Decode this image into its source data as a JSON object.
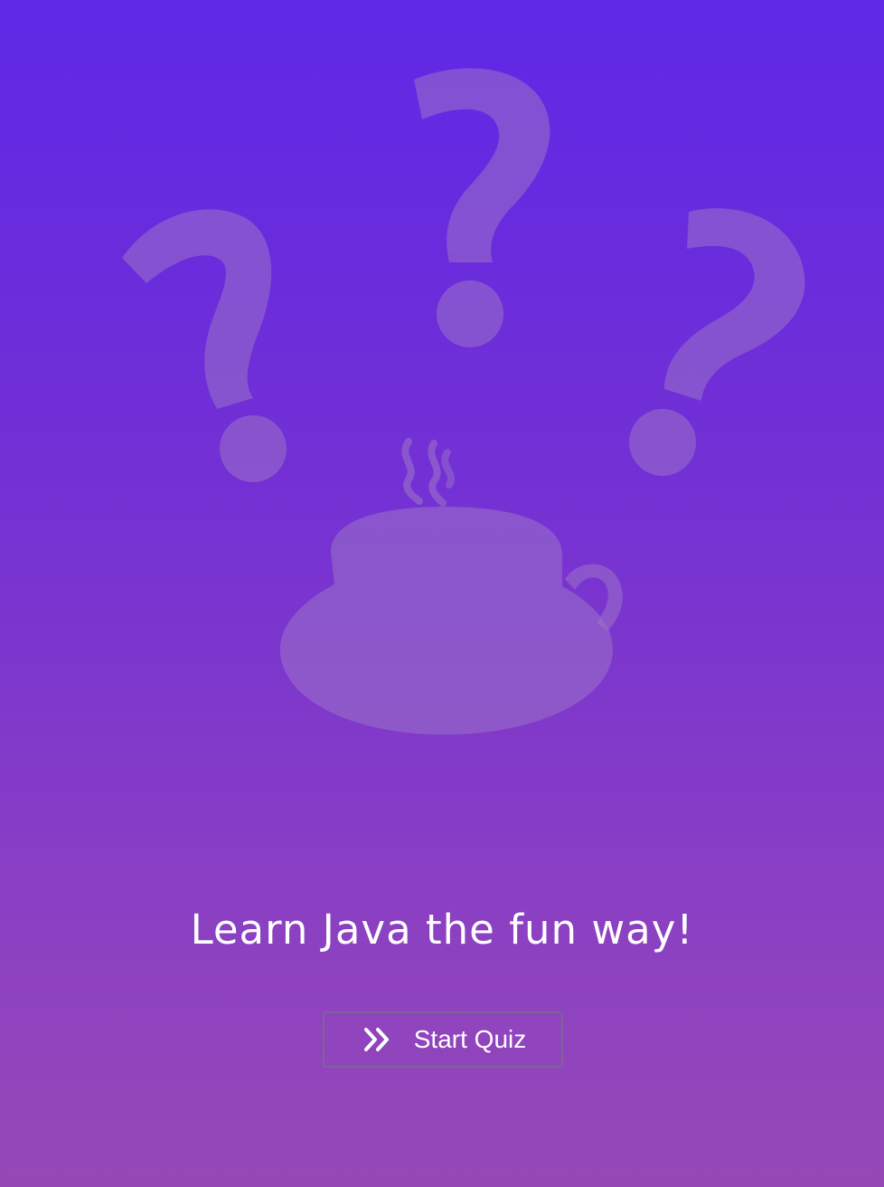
{
  "hero": {
    "decorations": [
      "question-mark-icon",
      "question-mark-icon",
      "question-mark-icon",
      "coffee-cup-icon"
    ]
  },
  "tagline": "Learn Java the fun way!",
  "start_button": {
    "label": "Start Quiz",
    "icon": "double-chevron-right-icon"
  },
  "colors": {
    "gradient_top": "#5e28e6",
    "gradient_bottom": "#9649b6",
    "decoration": "#8a5cc6",
    "text": "#ffffff"
  }
}
